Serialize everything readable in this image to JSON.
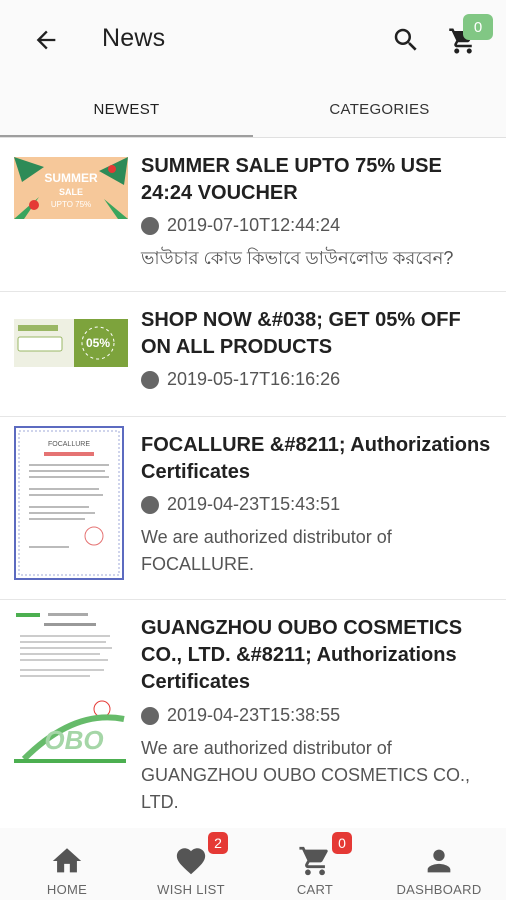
{
  "header": {
    "title": "News",
    "cart_count": "0",
    "back_icon": "arrow-left-icon",
    "search_icon": "search-icon",
    "cart_icon": "cart-icon"
  },
  "tabs": [
    {
      "label": "NEWEST",
      "selected": true
    },
    {
      "label": "CATEGORIES",
      "selected": false
    }
  ],
  "news": [
    {
      "title": "SUMMER SALE UPTO 75% USE 24:24 VOUCHER",
      "date": "2019-07-10T12:44:24",
      "excerpt": "ভাউচার কোড কিভাবে ডাউনলোড করবেন?",
      "thumb_text": "SUMMER SALE UPTO 75%"
    },
    {
      "title": "SHOP NOW &#038; GET 05% OFF ON ALL PRODUCTS",
      "date": "2019-05-17T16:16:26",
      "excerpt": "",
      "thumb_text": "05%"
    },
    {
      "title": "FOCALLURE &#8211; Authorizations Certificates",
      "date": "2019-04-23T15:43:51",
      "excerpt": "We are authorized distributor of FOCALLURE.",
      "thumb_text": "FOCALLURE"
    },
    {
      "title": "GUANGZHOU OUBO COSMETICS CO., LTD. &#8211; Authorizations Certificates",
      "date": "2019-04-23T15:38:55",
      "excerpt": "We are authorized distributor of GUANGZHOU OUBO COSMETICS CO., LTD.",
      "thumb_text": "OBO"
    }
  ],
  "bottom_nav": [
    {
      "label": "HOME",
      "icon": "home-icon"
    },
    {
      "label": "WISH LIST",
      "icon": "heart-icon",
      "badge": "2"
    },
    {
      "label": "CART",
      "icon": "cart-icon",
      "badge": "0"
    },
    {
      "label": "DASHBOARD",
      "icon": "person-icon"
    }
  ],
  "colors": {
    "cart_badge": "#81c784",
    "nav_badge": "#e53935",
    "icon": "#555555"
  }
}
